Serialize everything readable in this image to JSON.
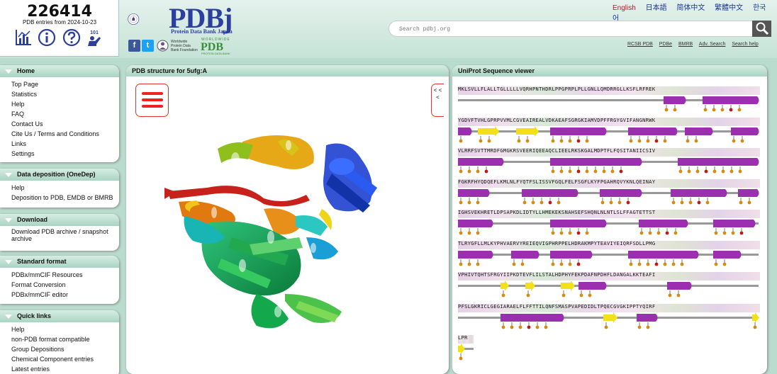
{
  "header": {
    "entry_count": "226414",
    "entry_sub": "PDB entries from 2024-10-23",
    "icons": [
      "stats-icon",
      "info-icon",
      "help-icon",
      "pdb101-icon"
    ],
    "icon_badge": "101",
    "logo_text": "PDBj",
    "logo_sub": "Protein Data Bank Japan",
    "logo_ring": "PROTEIN DATA BANK JAPAN · OSAKA UNIVERSITY",
    "social": [
      "f",
      "t"
    ],
    "wpdbf_text": "Worldwide Protein Data Bank Foundation",
    "wwpdb_label": "PDB",
    "wwpdb_top": "WORLDWIDE",
    "wwpdb_bottom": "PROTEIN DATA BANK",
    "languages": [
      "English",
      "日本語",
      "简体中文",
      "繁體中文",
      "한국어"
    ],
    "search_placeholder": "Search pdbj.org",
    "top_links": [
      "RCSB PDB",
      "PDBe",
      "BMRB",
      "Adv. Search",
      "Search help"
    ]
  },
  "colors": {
    "accent": "#c8102e",
    "link": "#1a33a0",
    "header_bg": "#c6e3d7"
  },
  "sidebar": [
    {
      "title": "Home",
      "items": [
        "Top Page",
        "Statistics",
        "Help",
        "FAQ",
        "Contact Us",
        "Cite Us / Terms and Conditions",
        "Links",
        "Settings"
      ]
    },
    {
      "title": "Data deposition (OneDep)",
      "items": [
        "Help",
        "Deposition to PDB, EMDB or BMRB"
      ]
    },
    {
      "title": "Download",
      "items": [
        "Download PDB archive / snapshot archive"
      ]
    },
    {
      "title": "Standard format",
      "items": [
        "PDBx/mmCIF Resources",
        "Format Conversion",
        "PDBx/mmCIF editor"
      ]
    },
    {
      "title": "Quick links",
      "items": [
        "Help",
        "non-PDB format compatible",
        "Group Depositions",
        "Chemical Component entries",
        "Latest entries"
      ]
    }
  ],
  "structure_panel": {
    "title": "PDB structure for 5ufg:A",
    "collapse_label": "< < <"
  },
  "sequence_panel": {
    "title": "UniProt Sequence viewer",
    "rows": [
      "MKLSVLLFLALLTGLLLLLVQRHPNTHDRLPPGPRPLPLLGNLLQMDRRGLLKSFLRFREK",
      "YGDVFTVHLGPRPVVMLCGVEAIREALVDKAEAFSGRGKIAMVDPFFRGYGVIFANGNRWK",
      "VLRRFSVTTMRDFGMGKRSVEERIQEEAQCLIEELRKSKGALMDPTFLFQSITANIICSIV",
      "FGKRFHYQDQEFLKMLNLFYQTFSLISSVFGQLFELFSGFLKYFPGAHRQVYKNLQEINAY",
      "IGHSVEKHRETLDPSAPKDLIDTYLLHMEKEKSNAHSEFSHQNLNLNTLSLFFAGTETTST",
      "TLRYGFLLMLKYPHVAERVYREIEQVIGPHRPPELHDRAKMPYTEAVIYEIQRFSDLLPMG",
      "VPHIVTQHTSFRGYIIPKDTEVFLILSTALHDPHYFEKPDAFNPDHFLDANGALKKTEAFI",
      "PFSLGKRICLGEGIARAELFLFFTTILQNFSMASPVAPEDIDLTPQECGVGKIPPTYQIRF",
      "LPR"
    ]
  }
}
